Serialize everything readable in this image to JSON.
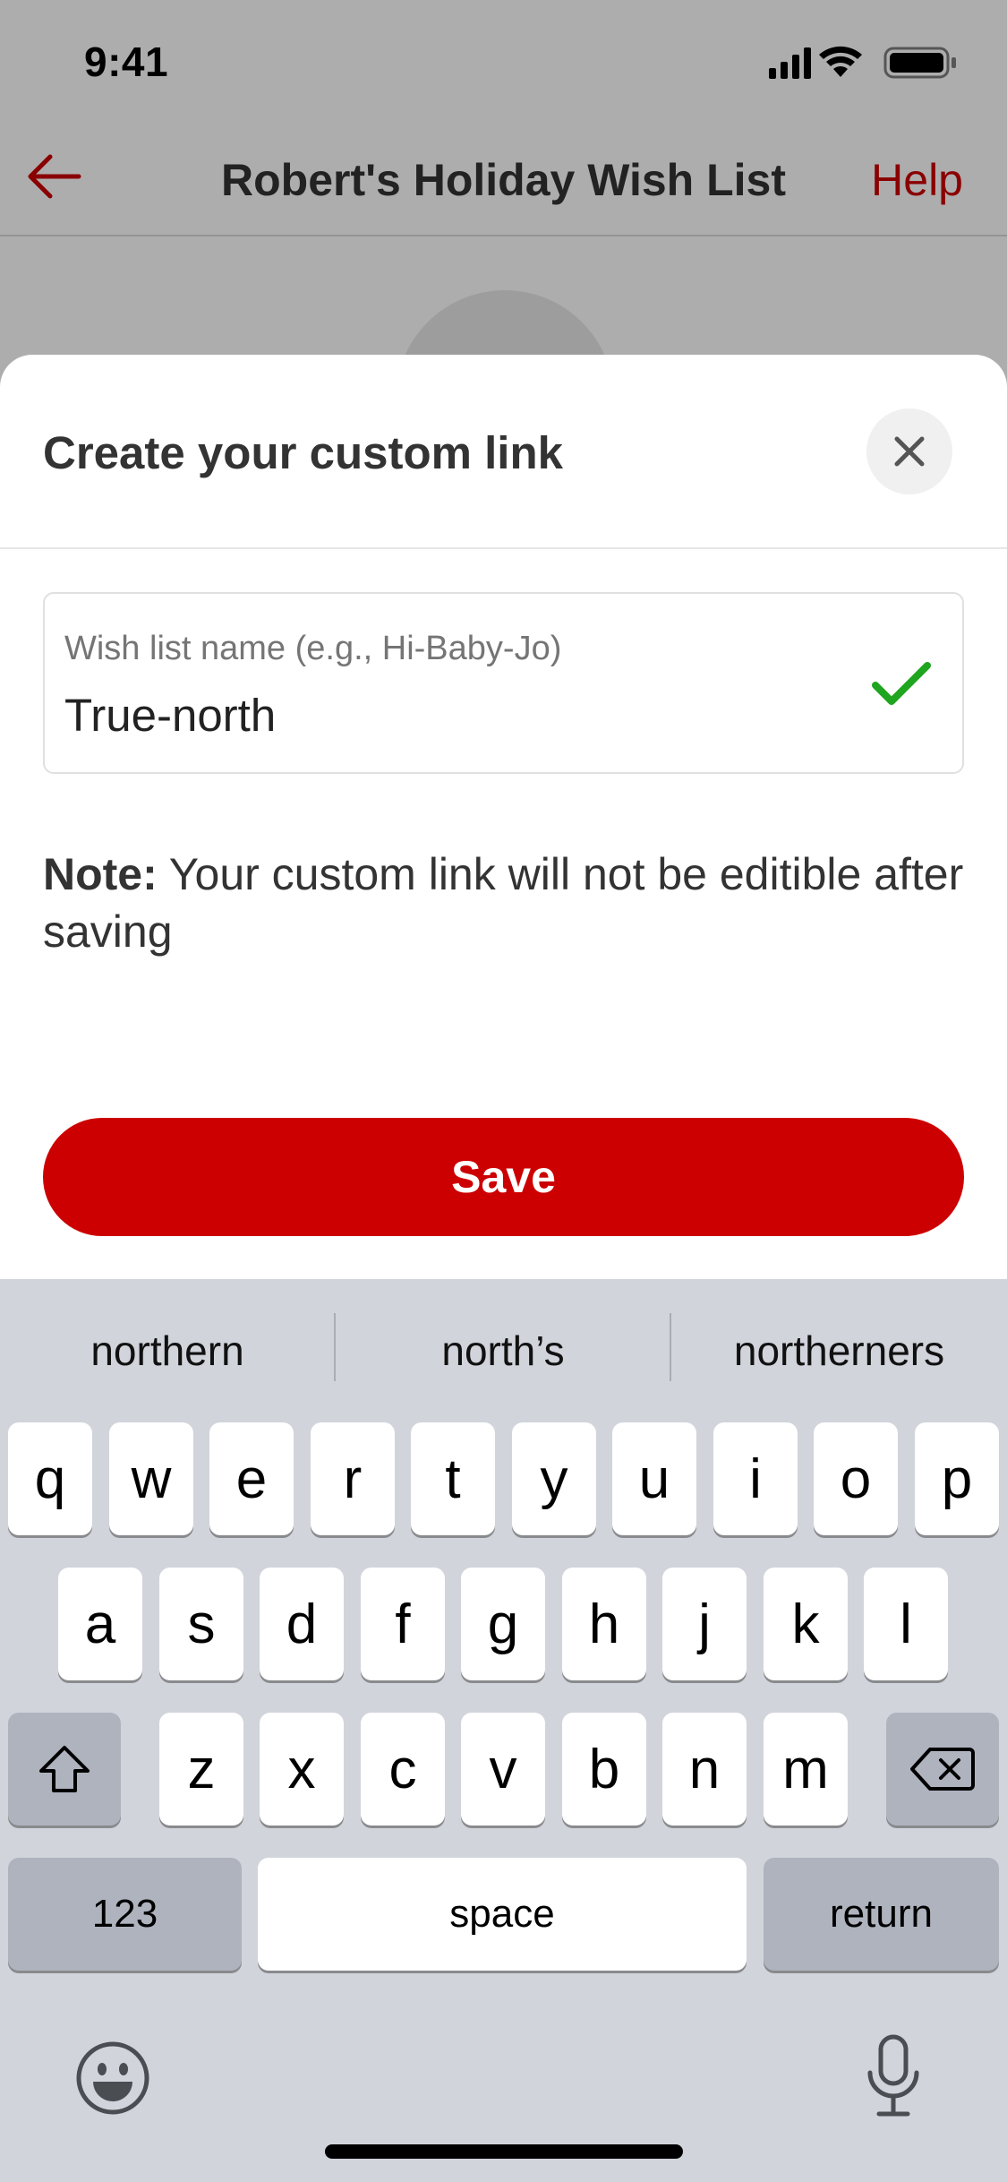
{
  "status_bar": {
    "time": "9:41"
  },
  "nav": {
    "title": "Robert's Holiday Wish List",
    "help_label": "Help"
  },
  "sheet": {
    "title": "Create your custom link",
    "field": {
      "label": "Wish list name (e.g., Hi-Baby-Jo)",
      "value": "True-north"
    },
    "note": {
      "prefix": "Note:",
      "text": " Your custom link will not be editible after saving"
    },
    "save_label": "Save"
  },
  "keyboard": {
    "suggestions": [
      "northern",
      "north’s",
      "northerners"
    ],
    "row1": [
      "q",
      "w",
      "e",
      "r",
      "t",
      "y",
      "u",
      "i",
      "o",
      "p"
    ],
    "row2": [
      "a",
      "s",
      "d",
      "f",
      "g",
      "h",
      "j",
      "k",
      "l"
    ],
    "row3": [
      "z",
      "x",
      "c",
      "v",
      "b",
      "n",
      "m"
    ],
    "numbers_label": "123",
    "space_label": "space",
    "return_label": "return"
  },
  "colors": {
    "accent": "#cc0000",
    "check": "#1fa51f",
    "keyboard_bg": "#d1d4db"
  }
}
